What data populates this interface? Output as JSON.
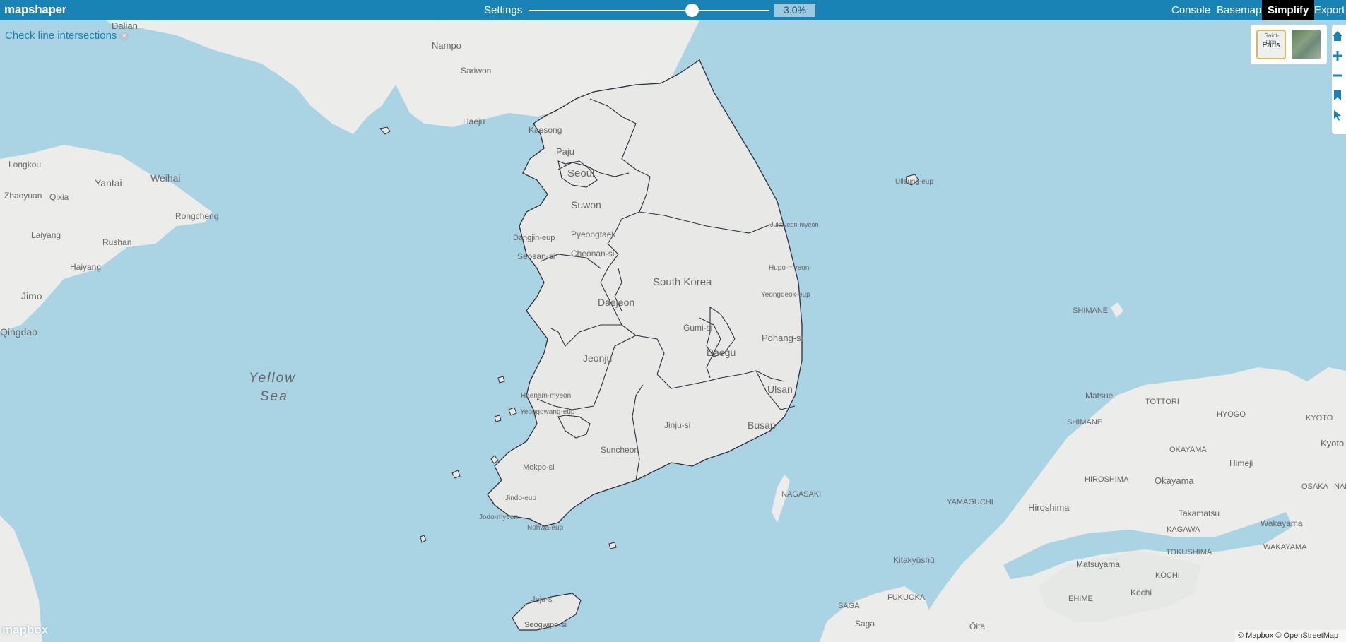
{
  "app": {
    "logo": "mapshaper"
  },
  "toolbar": {
    "settings_label": "Settings",
    "simplify_percent": "3.0%",
    "slider_value_fraction": 0.68,
    "menu": {
      "console": "Console",
      "basemap": "Basemap",
      "simplify": "Simplify",
      "export": "Export"
    },
    "active_menu": "Simplify"
  },
  "map": {
    "intersections_link": "Check line intersections",
    "basemap_thumbs": {
      "light_label": "Paris",
      "light_sublabel": "Saint-Deni"
    },
    "attribution": "© Mapbox © OpenStreetMap",
    "mapbox_logo": "mapbox",
    "labels": {
      "dalian": "Dalian",
      "nampo": "Nampo",
      "sariwon": "Sariwon",
      "haeju": "Haeju",
      "kaesong": "Kaesong",
      "paju": "Paju",
      "seoul": "Seoul",
      "suwon": "Suwon",
      "pyeongtaek": "Pyeongtaek",
      "dangjin": "Dangjin-eup",
      "seosan": "Seosan-si",
      "cheonan": "Cheonan-si",
      "south_korea": "South Korea",
      "daejeon": "Daejeon",
      "gumi": "Gumi-si",
      "daegu": "Daegu",
      "pohang": "Pohang-si",
      "jeonju": "Jeonju",
      "ulsan": "Ulsan",
      "jinju": "Jinju-si",
      "busan": "Busan",
      "suncheon": "Suncheon",
      "mokpo": "Mokpo-si",
      "haenam": "Haenam-myeon",
      "yeonggwang": "Yeonggwang-eup",
      "jindo": "Jindo-eup",
      "jodo": "Jodo-myeon",
      "nohwa": "Nohwa-eup",
      "jeju": "Jeju-si",
      "seogwipo": "Seogwipo-si",
      "uljin": "Ulleung-eup",
      "hupo": "Hupo-myeon",
      "yeongdeok": "Yeongdeok-eup",
      "jukbyeon": "Jukbyeon-myeon",
      "longkou": "Longkou",
      "yantai": "Yantai",
      "weihai": "Weihai",
      "zhaoyuan": "Zhaoyuan",
      "qixia": "Qixia",
      "laiyang": "Laiyang",
      "rongcheng": "Rongcheng",
      "rushan": "Rushan",
      "haiyang": "Haiyang",
      "jimo": "Jimo",
      "qingdao": "Qingdao",
      "yellow_sea_1": "Yellow",
      "yellow_sea_2": "Sea",
      "shimane_pref": "SHIMANE",
      "matsue": "Matsue",
      "shimane": "SHIMANE",
      "tottori": "TOTTORI",
      "hyogo": "HYOGO",
      "kyoto_pref": "KYOTO",
      "kyoto": "Kyoto",
      "okayama_pref": "OKAYAMA",
      "himeji": "Himeji",
      "hiroshima_pref": "HIROSHIMA",
      "okayama": "Okayama",
      "osaka": "OSAKA",
      "nara": "NARA",
      "yamaguchi": "YAMAGUCHI",
      "hiroshima": "Hiroshima",
      "takamatsu": "Takamatsu",
      "kagawa": "KAGAWA",
      "wakayama": "Wakayama",
      "tokushima": "TOKUSHIMA",
      "wakayama_pref": "WAKAYAMA",
      "nagasaki": "NAGASAKI",
      "matsuyama": "Matsuyama",
      "kochi_pref": "KŌCHI",
      "kitakyushu": "Kitakyūshū",
      "fukuoka": "FUKUOKA",
      "kochi": "Kōchi",
      "ehime": "EHIME",
      "saga_pref": "SAGA",
      "saga": "Saga",
      "oita": "Ōita"
    }
  },
  "colors": {
    "toolbar": "#1a83b5",
    "water": "#aad3e4",
    "land": "#ececea",
    "boundary": "#2b2f3a"
  }
}
